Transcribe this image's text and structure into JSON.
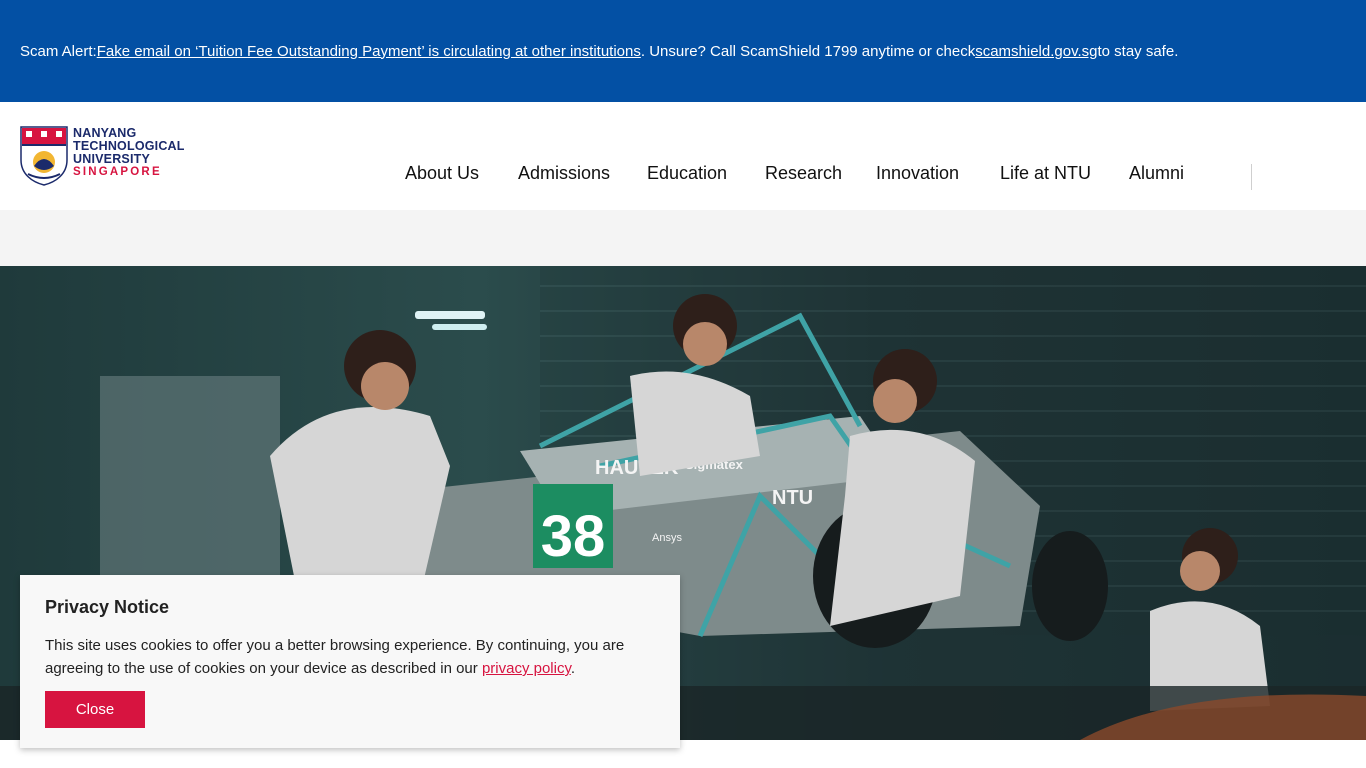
{
  "alert": {
    "prefix": "Scam Alert: ",
    "link1": "Fake email on ‘Tuition Fee Outstanding Payment’ is circulating at other institutions",
    "middle": ". Unsure? Call ScamShield 1799 anytime or check ",
    "link2": "scamshield.gov.sg",
    "suffix": " to stay safe."
  },
  "logo": {
    "line1": "NANYANG",
    "line2": "TECHNOLOGICAL",
    "line3": "UNIVERSITY",
    "line4": "SINGAPORE"
  },
  "nav": {
    "items": [
      {
        "label": "About Us"
      },
      {
        "label": "Admissions"
      },
      {
        "label": "Education"
      },
      {
        "label": "Research"
      },
      {
        "label": "Innovation"
      },
      {
        "label": "Life at NTU"
      },
      {
        "label": "Alumni"
      }
    ]
  },
  "hero": {
    "car_number": "38",
    "sponsor1": "HAUTEK",
    "sponsor2": "Sigmatex",
    "sponsor3": "Ansys",
    "team": "NTU"
  },
  "privacy": {
    "title": "Privacy Notice",
    "text": "This site uses cookies to offer you a better browsing experience. By continuing, you are agreeing to the use of cookies on your device as described in our ",
    "link": "privacy policy",
    "end": ".",
    "close_label": "Close"
  },
  "colors": {
    "alert_bg": "#0350a4",
    "brand_red": "#d71440",
    "brand_navy": "#1b2a6b"
  }
}
